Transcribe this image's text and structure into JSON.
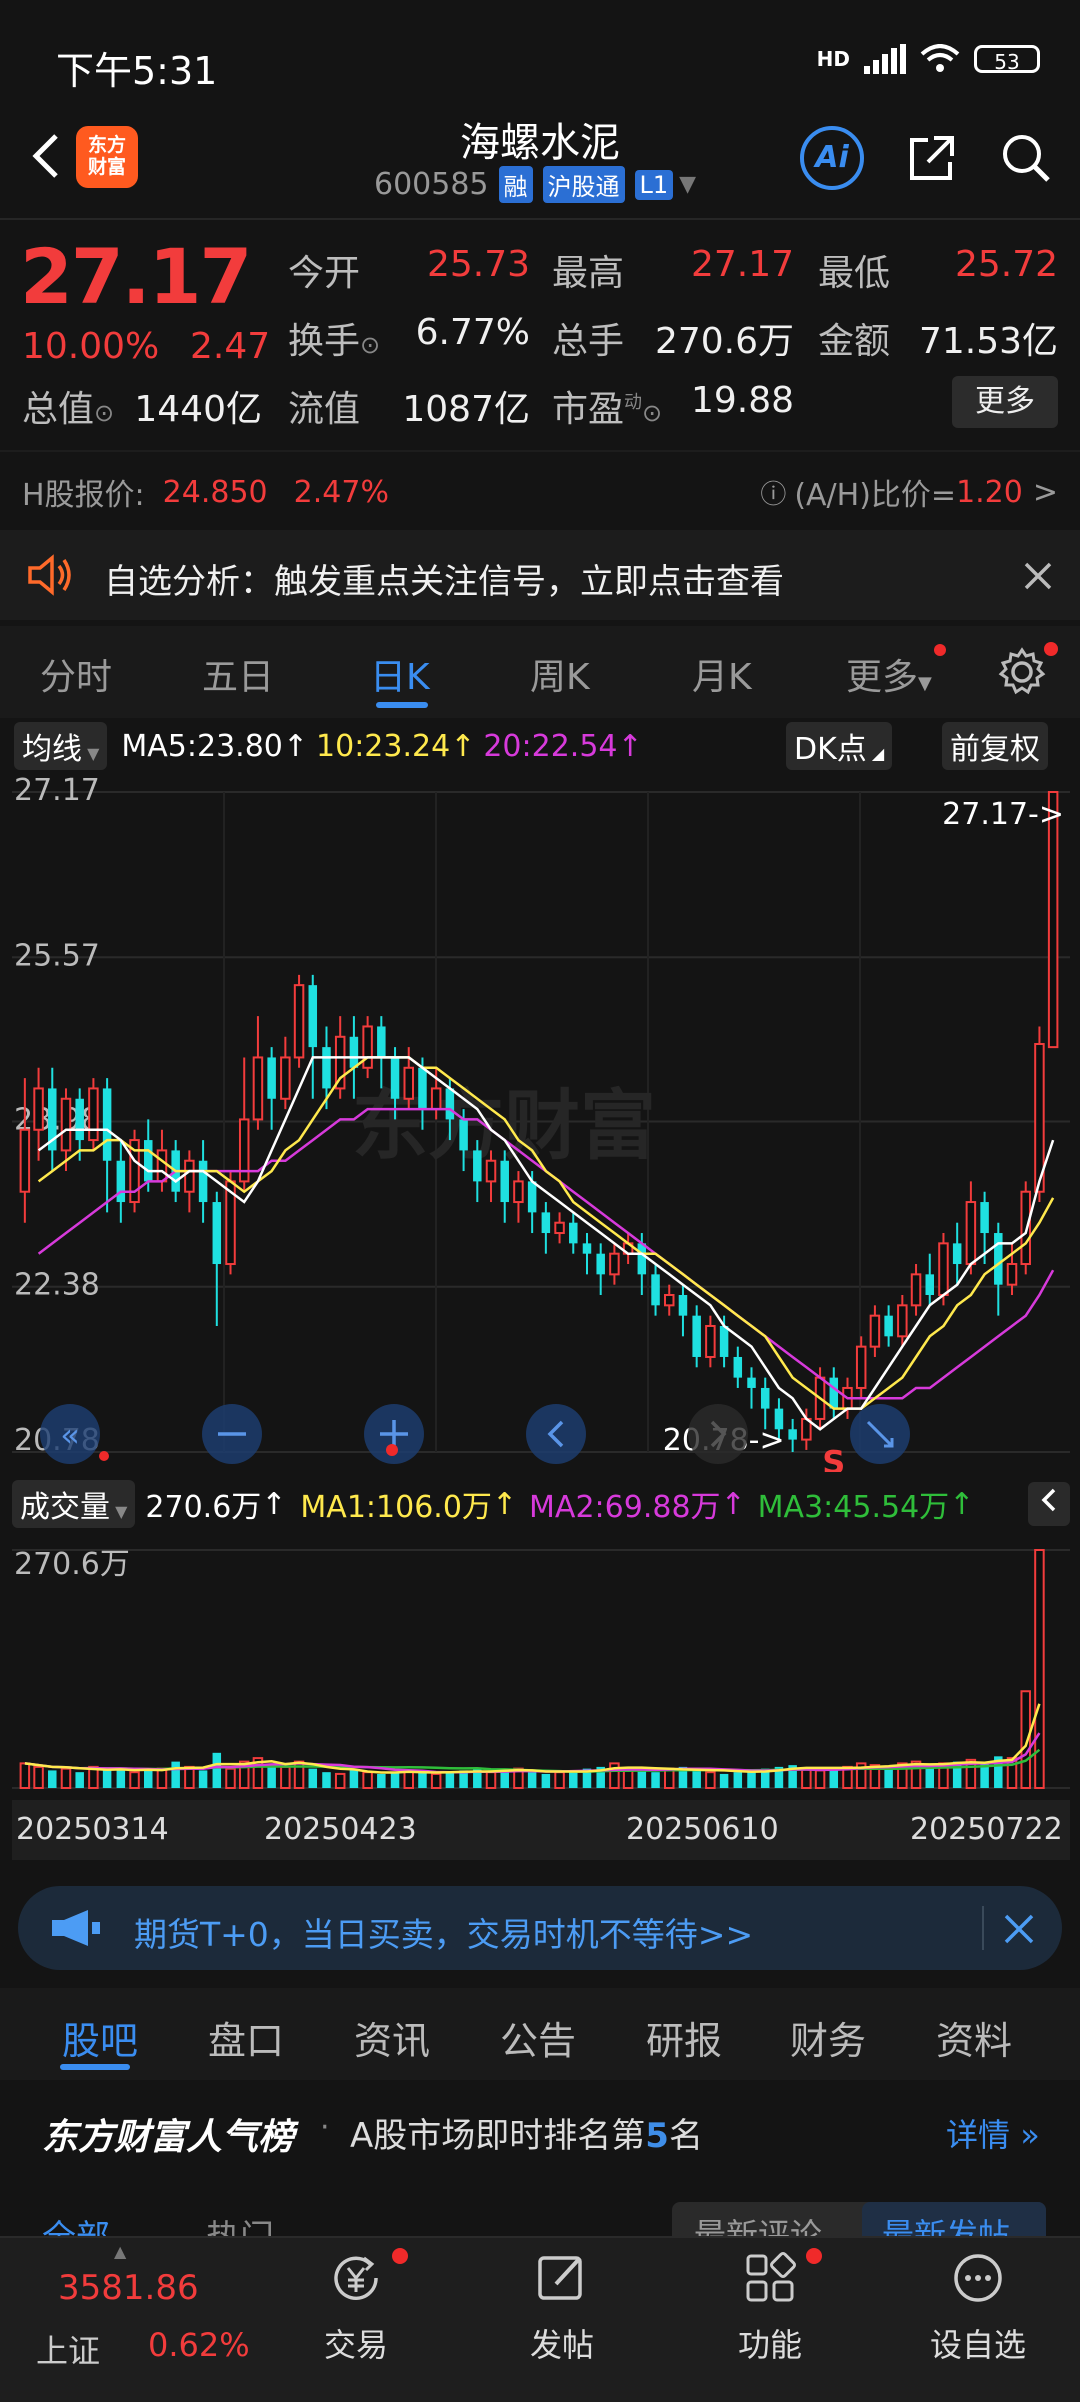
{
  "status": {
    "time": "下午5:31",
    "network": "HD",
    "battery": "53"
  },
  "header": {
    "logo_line1": "东方",
    "logo_line2": "财富",
    "stock_name": "海螺水泥",
    "stock_code": "600585",
    "tags": [
      "融",
      "沪股通",
      "L1"
    ],
    "ai_label": "Ai"
  },
  "quote": {
    "price": "27.17",
    "change_pct": "10.00%",
    "change": "2.47",
    "open_label": "今开",
    "open": "25.73",
    "high_label": "最高",
    "high": "27.17",
    "low_label": "最低",
    "low": "25.72",
    "turnover_label": "换手",
    "turnover": "6.77%",
    "volume_label": "总手",
    "volume": "270.6万",
    "amount_label": "金额",
    "amount": "71.53亿",
    "mktcap_label": "总值",
    "mktcap": "1440亿",
    "float_label": "流值",
    "float": "1087亿",
    "pe_label": "市盈",
    "pe_sup": "动",
    "pe": "19.88",
    "more_label": "更多"
  },
  "hshare": {
    "label": "H股报价:",
    "price": "24.850",
    "pct": "2.47%",
    "ah_label": "(A/H)比价=",
    "ah_value": "1.20",
    "arrow": ">"
  },
  "notice": {
    "text": "自选分析：触发重点关注信号，立即点击查看"
  },
  "period_tabs": [
    "分时",
    "五日",
    "日K",
    "周K",
    "月K",
    "更多"
  ],
  "active_period": "日K",
  "ma_bar": {
    "selector": "均线",
    "ma5": "MA5:23.80",
    "ma10": "10:23.24",
    "ma20": "20:22.54",
    "dk_label": "DK点",
    "adjust_label": "前复权"
  },
  "colors": {
    "up": "#f23c3c",
    "down": "#1fe0e0",
    "ma5": "#ffffff",
    "ma10": "#ffe94d",
    "ma20": "#d73adb",
    "vol_ma3": "#2fbe3a",
    "accent": "#3a8df0"
  },
  "chart_data": {
    "type": "candlestick",
    "y_ticks": [
      "27.17",
      "25.57",
      "23.98",
      "22.38",
      "20.78"
    ],
    "ylim": [
      20.78,
      27.17
    ],
    "last_label": "27.17->",
    "low_label": "20.78->",
    "signal_label": "S",
    "watermark": "东方财富",
    "x_labels": [
      "20250314",
      "20250423",
      "20250610",
      "20250722"
    ],
    "candles": [
      [
        23.3,
        23.9,
        24.4,
        23.0
      ],
      [
        23.9,
        24.3,
        24.5,
        23.6
      ],
      [
        24.3,
        23.7,
        24.5,
        23.5
      ],
      [
        23.7,
        24.2,
        24.3,
        23.5
      ],
      [
        24.2,
        23.8,
        24.3,
        23.6
      ],
      [
        23.8,
        24.3,
        24.4,
        23.7
      ],
      [
        24.3,
        23.6,
        24.4,
        23.1
      ],
      [
        23.6,
        23.2,
        23.8,
        23.0
      ],
      [
        23.2,
        23.8,
        23.9,
        23.1
      ],
      [
        23.8,
        23.4,
        24.0,
        23.3
      ],
      [
        23.4,
        23.7,
        23.9,
        23.3
      ],
      [
        23.7,
        23.3,
        23.8,
        23.2
      ],
      [
        23.3,
        23.6,
        23.7,
        23.1
      ],
      [
        23.6,
        23.2,
        23.8,
        23.0
      ],
      [
        23.2,
        22.6,
        23.3,
        22.0
      ],
      [
        22.6,
        23.4,
        23.5,
        22.5
      ],
      [
        23.4,
        24.0,
        24.6,
        23.3
      ],
      [
        24.0,
        24.6,
        25.0,
        23.9
      ],
      [
        24.6,
        24.2,
        24.7,
        23.9
      ],
      [
        24.2,
        24.6,
        24.8,
        24.1
      ],
      [
        24.6,
        25.3,
        25.4,
        24.5
      ],
      [
        25.3,
        24.7,
        25.4,
        24.2
      ],
      [
        24.7,
        24.3,
        24.9,
        24.1
      ],
      [
        24.3,
        24.8,
        25.0,
        24.2
      ],
      [
        24.8,
        24.5,
        25.0,
        24.2
      ],
      [
        24.5,
        24.9,
        25.0,
        24.4
      ],
      [
        24.9,
        24.6,
        25.0,
        24.3
      ],
      [
        24.6,
        24.2,
        24.7,
        24.0
      ],
      [
        24.2,
        24.5,
        24.7,
        24.1
      ],
      [
        24.5,
        24.1,
        24.6,
        23.9
      ],
      [
        24.1,
        24.3,
        24.5,
        24.0
      ],
      [
        24.3,
        24.0,
        24.4,
        23.8
      ],
      [
        24.0,
        23.7,
        24.1,
        23.5
      ],
      [
        23.7,
        23.4,
        23.8,
        23.2
      ],
      [
        23.4,
        23.6,
        23.7,
        23.2
      ],
      [
        23.6,
        23.2,
        23.7,
        23.0
      ],
      [
        23.2,
        23.4,
        23.5,
        23.0
      ],
      [
        23.4,
        23.1,
        23.5,
        22.9
      ],
      [
        23.1,
        22.9,
        23.2,
        22.7
      ],
      [
        22.9,
        23.0,
        23.1,
        22.8
      ],
      [
        23.0,
        22.8,
        23.1,
        22.7
      ],
      [
        22.8,
        22.7,
        22.9,
        22.5
      ],
      [
        22.7,
        22.5,
        22.8,
        22.3
      ],
      [
        22.5,
        22.7,
        22.8,
        22.4
      ],
      [
        22.7,
        22.8,
        22.9,
        22.6
      ],
      [
        22.8,
        22.5,
        22.9,
        22.3
      ],
      [
        22.5,
        22.2,
        22.6,
        22.1
      ],
      [
        22.2,
        22.3,
        22.4,
        22.1
      ],
      [
        22.3,
        22.1,
        22.4,
        21.9
      ],
      [
        22.1,
        21.7,
        22.2,
        21.6
      ],
      [
        21.7,
        22.0,
        22.1,
        21.6
      ],
      [
        22.0,
        21.7,
        22.1,
        21.6
      ],
      [
        21.7,
        21.5,
        21.8,
        21.4
      ],
      [
        21.5,
        21.4,
        21.6,
        21.2
      ],
      [
        21.4,
        21.2,
        21.5,
        21.0
      ],
      [
        21.2,
        21.0,
        21.3,
        20.9
      ],
      [
        21.0,
        20.9,
        21.1,
        20.78
      ],
      [
        20.9,
        21.1,
        21.2,
        20.8
      ],
      [
        21.1,
        21.5,
        21.6,
        21.0
      ],
      [
        21.5,
        21.2,
        21.6,
        21.1
      ],
      [
        21.2,
        21.4,
        21.5,
        21.1
      ],
      [
        21.4,
        21.8,
        21.9,
        21.3
      ],
      [
        21.8,
        22.1,
        22.2,
        21.7
      ],
      [
        22.1,
        21.9,
        22.2,
        21.8
      ],
      [
        21.9,
        22.2,
        22.3,
        21.8
      ],
      [
        22.2,
        22.5,
        22.6,
        22.1
      ],
      [
        22.5,
        22.3,
        22.7,
        22.2
      ],
      [
        22.3,
        22.8,
        22.9,
        22.2
      ],
      [
        22.8,
        22.6,
        23.0,
        22.4
      ],
      [
        22.6,
        23.2,
        23.4,
        22.5
      ],
      [
        23.2,
        22.9,
        23.3,
        22.6
      ],
      [
        22.9,
        22.4,
        23.0,
        22.1
      ],
      [
        22.4,
        22.6,
        22.8,
        22.3
      ],
      [
        22.6,
        23.3,
        23.4,
        22.5
      ],
      [
        23.3,
        24.73,
        24.9,
        23.2
      ],
      [
        24.7,
        27.17,
        27.17,
        25.72
      ]
    ],
    "ma5": [
      23.7,
      23.8,
      23.9,
      23.9,
      23.9,
      23.9,
      23.8,
      23.6,
      23.5,
      23.5,
      23.4,
      23.5,
      23.5,
      23.4,
      23.3,
      23.2,
      23.4,
      23.7,
      24.0,
      24.3,
      24.6,
      24.6,
      24.6,
      24.6,
      24.6,
      24.6,
      24.6,
      24.6,
      24.5,
      24.4,
      24.3,
      24.2,
      24.1,
      23.9,
      23.8,
      23.6,
      23.4,
      23.3,
      23.2,
      23.1,
      23.0,
      22.9,
      22.8,
      22.7,
      22.7,
      22.6,
      22.5,
      22.4,
      22.3,
      22.2,
      22.0,
      21.9,
      21.8,
      21.6,
      21.4,
      21.3,
      21.1,
      21.0,
      21.1,
      21.2,
      21.2,
      21.4,
      21.6,
      21.8,
      22.0,
      22.2,
      22.3,
      22.4,
      22.6,
      22.7,
      22.8,
      22.8,
      22.9,
      23.4,
      23.8
    ],
    "ma10": [
      23.4,
      23.5,
      23.6,
      23.7,
      23.7,
      23.8,
      23.8,
      23.7,
      23.7,
      23.6,
      23.5,
      23.5,
      23.5,
      23.5,
      23.4,
      23.3,
      23.4,
      23.5,
      23.7,
      23.8,
      24.0,
      24.2,
      24.4,
      24.5,
      24.6,
      24.6,
      24.6,
      24.6,
      24.5,
      24.5,
      24.4,
      24.3,
      24.2,
      24.1,
      24.0,
      23.8,
      23.7,
      23.5,
      23.4,
      23.2,
      23.1,
      23.0,
      22.9,
      22.8,
      22.7,
      22.7,
      22.6,
      22.5,
      22.4,
      22.3,
      22.2,
      22.1,
      22.0,
      21.9,
      21.7,
      21.5,
      21.4,
      21.3,
      21.2,
      21.2,
      21.2,
      21.3,
      21.4,
      21.5,
      21.7,
      21.9,
      22.0,
      22.2,
      22.3,
      22.5,
      22.6,
      22.7,
      22.8,
      23.0,
      23.24
    ],
    "ma20": [
      22.7,
      22.8,
      22.9,
      23.0,
      23.1,
      23.2,
      23.3,
      23.3,
      23.4,
      23.4,
      23.5,
      23.5,
      23.5,
      23.5,
      23.5,
      23.5,
      23.5,
      23.6,
      23.6,
      23.7,
      23.8,
      23.9,
      24.0,
      24.0,
      24.1,
      24.1,
      24.1,
      24.1,
      24.1,
      24.1,
      24.1,
      24.0,
      24.0,
      23.9,
      23.8,
      23.7,
      23.6,
      23.5,
      23.4,
      23.3,
      23.2,
      23.1,
      23.0,
      22.9,
      22.8,
      22.7,
      22.6,
      22.5,
      22.4,
      22.3,
      22.2,
      22.1,
      22.0,
      21.9,
      21.8,
      21.7,
      21.6,
      21.5,
      21.4,
      21.3,
      21.3,
      21.3,
      21.3,
      21.3,
      21.4,
      21.4,
      21.5,
      21.6,
      21.7,
      21.8,
      21.9,
      22.0,
      22.1,
      22.3,
      22.54
    ]
  },
  "volume": {
    "selector": "成交量",
    "current": "270.6万",
    "ma1": "MA1:106.0万",
    "ma2": "MA2:69.88万",
    "ma3": "MA3:45.54万",
    "ymax_label": "270.6万",
    "values": [
      28,
      24,
      20,
      22,
      18,
      24,
      20,
      22,
      18,
      20,
      22,
      30,
      24,
      20,
      40,
      22,
      30,
      34,
      26,
      24,
      30,
      22,
      18,
      16,
      20,
      18,
      16,
      18,
      20,
      18,
      16,
      18,
      20,
      22,
      18,
      20,
      22,
      18,
      16,
      18,
      20,
      22,
      24,
      28,
      22,
      20,
      18,
      22,
      24,
      20,
      18,
      16,
      18,
      20,
      22,
      24,
      26,
      22,
      20,
      22,
      24,
      28,
      26,
      24,
      28,
      30,
      26,
      28,
      30,
      32,
      28,
      36,
      34,
      110,
      270.6
    ]
  },
  "ad": {
    "text": "期货T+0，当日买卖，交易时机不等待>>"
  },
  "info_tabs": [
    "股吧",
    "盘口",
    "资讯",
    "公告",
    "研报",
    "财务",
    "资料"
  ],
  "active_info_tab": "股吧",
  "rank": {
    "title": "东方财富人气榜",
    "dot": "·",
    "desc_prefix": "A股市场即时排名第",
    "rank": "5",
    "desc_suffix": "名",
    "detail": "详情"
  },
  "filters": {
    "all": "全部",
    "hot": "热门",
    "latest_comment": "最新评论",
    "latest_post": "最新发帖"
  },
  "bottom": {
    "index_value": "3581.86",
    "index_name": "上证",
    "index_pct": "0.62%",
    "nav": [
      "交易",
      "发帖",
      "功能",
      "设自选"
    ]
  }
}
